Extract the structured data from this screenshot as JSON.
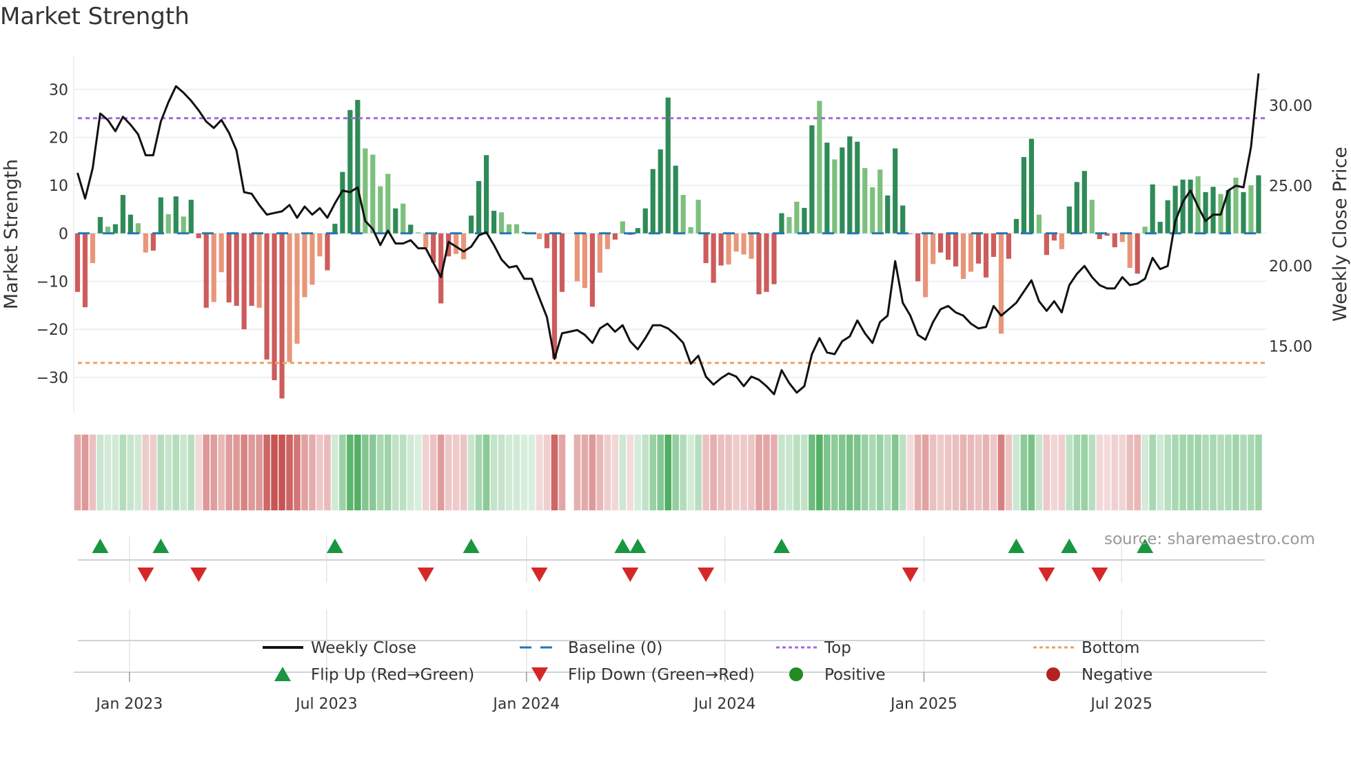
{
  "chart_data": {
    "type": "bar",
    "title": "Market Strength",
    "ylabel": "Market Strength",
    "y2label": "Weekly Close Price",
    "source": "source: sharemaestro.com",
    "ylim": [
      -37.2,
      37.0
    ],
    "y2lim": [
      10.9,
      33.1
    ],
    "xlim": [
      -0.5,
      157.1
    ],
    "y_ticks": [
      {
        "value": -30,
        "label": "−30"
      },
      {
        "value": -20,
        "label": "−20"
      },
      {
        "value": -10,
        "label": "−10"
      },
      {
        "value": 0,
        "label": "0"
      },
      {
        "value": 10,
        "label": "10"
      },
      {
        "value": 20,
        "label": "20"
      },
      {
        "value": 30,
        "label": "30"
      }
    ],
    "y2_ticks": [
      {
        "value": 15,
        "label": "15.00"
      },
      {
        "value": 20,
        "label": "20.00"
      },
      {
        "value": 25,
        "label": "25.00"
      },
      {
        "value": 30,
        "label": "30.00"
      }
    ],
    "x_ticks": [
      {
        "week": 6.86,
        "label": "Jan 2023"
      },
      {
        "week": 32.9,
        "label": "Jul 2023"
      },
      {
        "week": 59.3,
        "label": "Jan 2024"
      },
      {
        "week": 85.5,
        "label": "Jul 2024"
      },
      {
        "week": 111.8,
        "label": "Jan 2025"
      },
      {
        "week": 137.9,
        "label": "Jul 2025"
      }
    ],
    "top_level": 24,
    "bottom_level": -27,
    "baseline": 0,
    "strength": [
      -12.2,
      -15.4,
      -6.2,
      3.4,
      1.4,
      1.9,
      8.0,
      3.9,
      2.1,
      -4.0,
      -3.6,
      7.5,
      4.0,
      7.7,
      3.5,
      7.0,
      -1.0,
      -15.5,
      -14.3,
      -8.1,
      -14.4,
      -15.1,
      -20.0,
      -15.1,
      -15.5,
      -26.3,
      -30.6,
      -34.4,
      -26.8,
      -23.0,
      -13.3,
      -10.7,
      -4.8,
      -7.7,
      2.0,
      12.8,
      25.7,
      27.8,
      17.7,
      16.4,
      9.8,
      12.4,
      5.2,
      6.2,
      1.8,
      0.2,
      -3.0,
      -6.1,
      -14.6,
      -4.8,
      -4.3,
      -5.4,
      3.7,
      10.9,
      16.3,
      4.7,
      4.4,
      1.9,
      1.9,
      0.3,
      0.2,
      -1.2,
      -3.1,
      -26.1,
      -12.2,
      null,
      -10.0,
      -11.4,
      -15.3,
      -8.2,
      -3.3,
      -1.3,
      2.5,
      -0.3,
      1.1,
      5.2,
      13.4,
      17.5,
      28.3,
      14.1,
      8.0,
      1.3,
      7.0,
      -6.2,
      -10.3,
      -6.7,
      -6.5,
      -3.8,
      -4.4,
      -5.3,
      -12.7,
      -12.2,
      -10.6,
      4.2,
      3.4,
      6.6,
      5.3,
      22.5,
      27.6,
      18.9,
      15.4,
      17.9,
      20.2,
      19.1,
      13.6,
      9.6,
      13.3,
      7.9,
      17.7,
      5.8,
      -0.2,
      -10.0,
      -13.3,
      -6.4,
      -4.0,
      -5.5,
      -6.9,
      -9.5,
      -8.0,
      -6.3,
      -9.2,
      -4.9,
      -20.9,
      -5.3,
      3.0,
      15.9,
      19.7,
      3.9,
      -4.5,
      -1.5,
      -3.3,
      5.6,
      10.7,
      13.0,
      7.0,
      -1.2,
      -0.5,
      -2.9,
      -1.8,
      -7.2,
      -8.4,
      1.4,
      10.2,
      2.4,
      6.9,
      9.9,
      11.2,
      11.2,
      11.9,
      8.6,
      9.7,
      8.2,
      9.0,
      11.6,
      8.6,
      10.0,
      12.1
    ],
    "shade": "ddldldddllddldldddllddddldddllllldddddlllldldlldddllddddllldllddddlldlldldddddddllldddllllddddllddldldddllldddldlldddlldddlddddlddldddldddlldlddddddlddldldldlldd",
    "weekly_close": [
      25.8,
      24.2,
      26.1,
      29.5,
      29.1,
      28.4,
      29.3,
      28.8,
      28.2,
      26.9,
      26.9,
      29.0,
      30.2,
      31.2,
      30.8,
      30.3,
      29.7,
      29.0,
      28.6,
      29.1,
      28.3,
      27.2,
      24.6,
      24.5,
      23.8,
      23.2,
      23.3,
      23.4,
      23.8,
      23.0,
      23.7,
      23.2,
      23.6,
      23.0,
      23.9,
      24.7,
      24.6,
      24.9,
      22.8,
      22.3,
      21.3,
      22.2,
      21.4,
      21.4,
      21.6,
      21.1,
      21.1,
      20.2,
      19.3,
      21.5,
      21.2,
      20.9,
      21.2,
      21.9,
      22.1,
      21.3,
      20.4,
      19.9,
      20.0,
      19.2,
      19.2,
      18.0,
      16.8,
      14.2,
      15.8,
      15.9,
      16.0,
      15.7,
      15.2,
      16.1,
      16.4,
      15.9,
      16.3,
      15.3,
      14.8,
      15.5,
      16.3,
      16.3,
      16.1,
      15.7,
      15.2,
      13.9,
      14.4,
      13.1,
      12.6,
      13.0,
      13.3,
      13.1,
      12.5,
      13.1,
      12.9,
      12.5,
      12.0,
      13.5,
      12.7,
      12.1,
      12.5,
      14.5,
      15.5,
      14.6,
      14.5,
      15.3,
      15.6,
      16.6,
      15.8,
      15.2,
      16.5,
      16.9,
      20.3,
      17.7,
      16.9,
      15.7,
      15.4,
      16.5,
      17.3,
      17.5,
      17.1,
      16.9,
      16.4,
      16.1,
      16.2,
      17.5,
      16.9,
      17.3,
      17.7,
      18.4,
      19.1,
      17.8,
      17.2,
      17.8,
      17.1,
      18.8,
      19.5,
      20.0,
      19.3,
      18.8,
      18.6,
      18.6,
      19.3,
      18.8,
      18.9,
      19.2,
      20.5,
      19.8,
      20.0,
      22.8,
      24.0,
      24.7,
      23.7,
      22.8,
      23.2,
      23.2,
      24.7,
      25.0,
      24.9,
      27.4,
      32.0
    ],
    "flip_up_weeks": [
      3,
      11,
      34,
      52,
      72,
      74,
      93,
      124,
      131,
      141
    ],
    "flip_down_weeks": [
      9,
      16,
      46,
      61,
      73,
      83,
      110,
      128,
      135
    ],
    "colors": {
      "pos_strong": "#2e8b57",
      "pos_weak": "#7dbf7d",
      "neg_strong": "#cd5c5c",
      "neg_weak": "#e8967a",
      "line": "#111111",
      "baseline": "#1f77b4",
      "top": "#a368e0",
      "bottom": "#eda060",
      "flip_up": "#1a9641",
      "flip_down": "#d62728",
      "positive": "#228b22",
      "negative": "#b22222"
    },
    "legend": {
      "placement": "bottom",
      "items": [
        {
          "key": "weekly_close",
          "label": "Weekly Close"
        },
        {
          "key": "baseline",
          "label": "Baseline (0)"
        },
        {
          "key": "top",
          "label": "Top"
        },
        {
          "key": "bottom",
          "label": "Bottom"
        },
        {
          "key": "flip_up",
          "label": "Flip Up (Red→Green)"
        },
        {
          "key": "flip_down",
          "label": "Flip Down (Green→Red)"
        },
        {
          "key": "positive",
          "label": "Positive"
        },
        {
          "key": "negative",
          "label": "Negative"
        }
      ]
    }
  }
}
